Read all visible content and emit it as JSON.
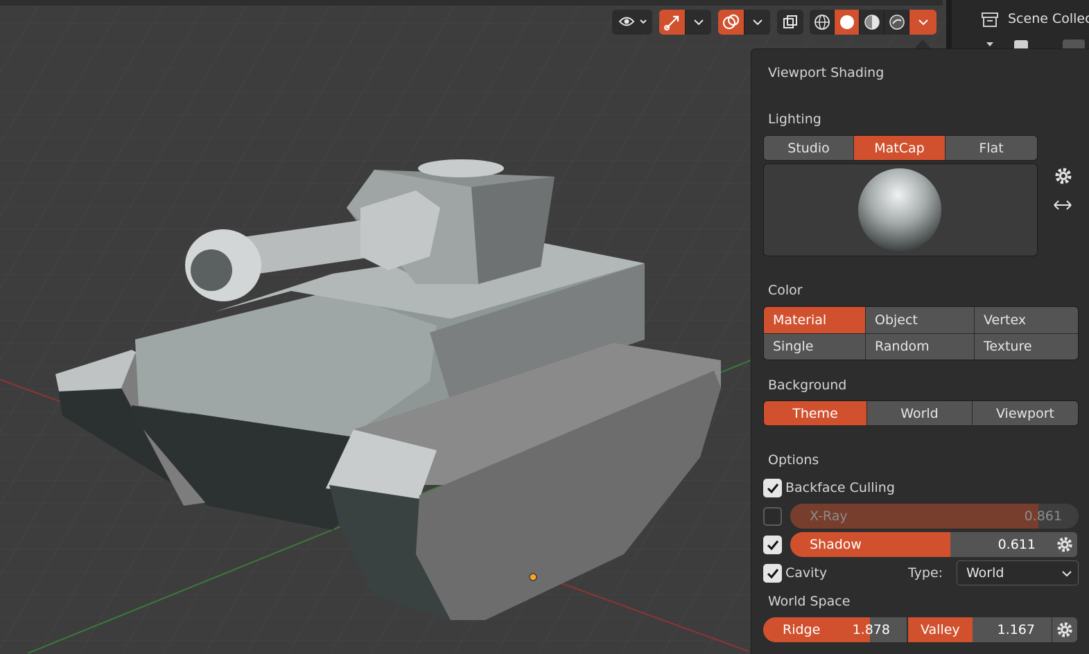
{
  "header": {
    "icons": [
      "eye-icon",
      "chevron-down-icon",
      "gizmo-icon",
      "chevron-down-icon",
      "overlay-icon",
      "chevron-down-icon",
      "xray-toggle-icon",
      "wireframe-shading-icon",
      "solid-shading-icon",
      "material-preview-icon",
      "rendered-shading-icon",
      "chevron-down-icon"
    ]
  },
  "outliner": {
    "scene_collection": "Scene Collec"
  },
  "popover": {
    "title": "Viewport Shading",
    "lighting": {
      "label": "Lighting",
      "options": [
        "Studio",
        "MatCap",
        "Flat"
      ],
      "selected": "MatCap"
    },
    "color": {
      "label": "Color",
      "options": [
        "Material",
        "Object",
        "Vertex",
        "Single",
        "Random",
        "Texture"
      ],
      "selected": "Material"
    },
    "background": {
      "label": "Background",
      "options": [
        "Theme",
        "World",
        "Viewport"
      ],
      "selected": "Theme"
    },
    "options": {
      "label": "Options",
      "backface_culling": {
        "label": "Backface Culling",
        "checked": true
      },
      "xray": {
        "label": "X-Ray",
        "checked": false,
        "value": "0.861",
        "fraction": 0.861
      },
      "shadow": {
        "label": "Shadow",
        "checked": true,
        "value": "0.611",
        "fraction": 0.611
      },
      "cavity": {
        "label": "Cavity",
        "checked": true
      },
      "cavity_type": {
        "label": "Type:",
        "value": "World"
      }
    },
    "world_space": {
      "label": "World Space",
      "ridge": {
        "label": "Ridge",
        "value": "1.878"
      },
      "valley": {
        "label": "Valley",
        "value": "1.167"
      }
    }
  },
  "colors": {
    "accent": "#d1512f",
    "panel": "#2d2d2d",
    "button": "#545454",
    "viewport": "#3d3d3d"
  }
}
